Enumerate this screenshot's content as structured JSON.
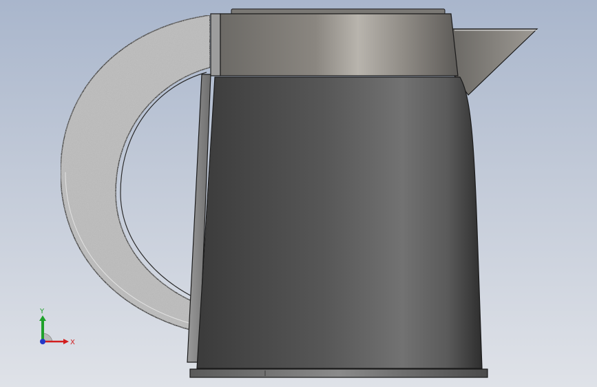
{
  "viewport": {
    "background_top": "#a9b6cc",
    "background_bottom": "#dfe2e8"
  },
  "model": {
    "name": "",
    "parts": [
      "handle",
      "lid",
      "body",
      "spout",
      "base-ring"
    ],
    "colors": {
      "body_dark": "#3a3a3a",
      "body_mid": "#6f6f6f",
      "lid_light": "#b3afa8",
      "handle_stone": "#b8b8b8",
      "outline": "#1a1a1a"
    }
  },
  "triad": {
    "x_label": "X",
    "y_label": "Y",
    "x_color": "#d21e1e",
    "y_color": "#1fa12b",
    "z_color": "#2438c8"
  }
}
